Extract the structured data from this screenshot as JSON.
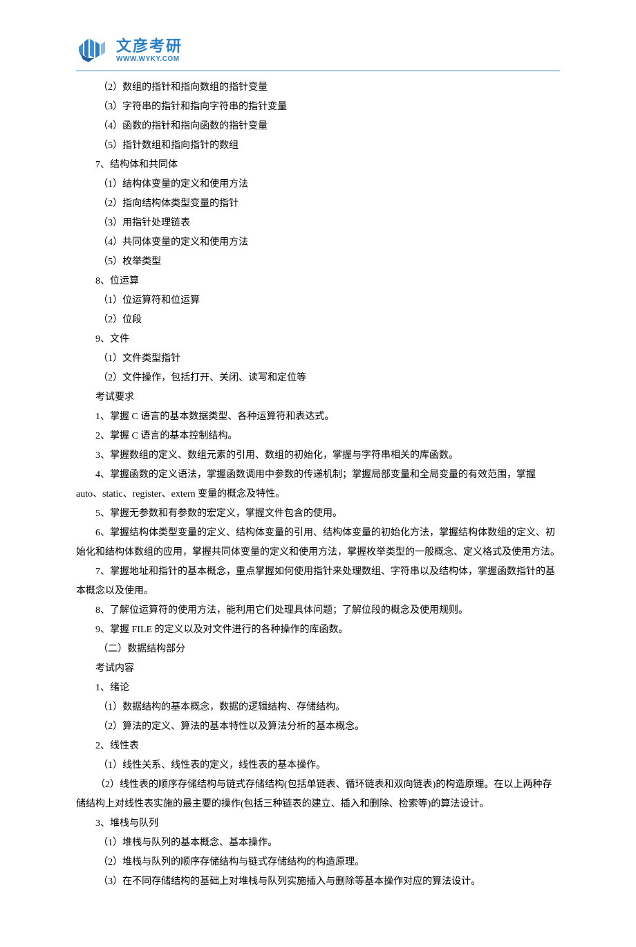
{
  "logo": {
    "cn": "文彦考研",
    "en": "WWW.WYKY.COM"
  },
  "lines": [
    "（2）数组的指针和指向数组的指针变量",
    "（3）字符串的指针和指向字符串的指针变量",
    "（4）函数的指针和指向函数的指针变量",
    "（5）指针数组和指向指针的数组",
    "7、结构体和共同体",
    "（1）结构体变量的定义和使用方法",
    "（2）指向结构体类型变量的指针",
    "（3）用指针处理链表",
    "（4）共同体变量的定义和使用方法",
    "（5）枚举类型",
    "8、位运算",
    "（1）位运算符和位运算",
    "（2）位段",
    "9、文件",
    "（1）文件类型指针",
    "（2）文件操作，包括打开、关闭、读写和定位等",
    "考试要求",
    "1、掌握 C 语言的基本数据类型、各种运算符和表达式。",
    "2、掌握 C 语言的基本控制结构。",
    "3、掌握数组的定义、数组元素的引用、数组的初始化，掌握与字符串相关的库函数。",
    "4、掌握函数的定义语法，掌握函数调用中参数的传递机制；掌握局部变量和全局变量的有效范围，掌握 auto、static、register、extern 变量的概念及特性。",
    "5、掌握无参数和有参数的宏定义，掌握文件包含的使用。",
    "6、掌握结构体类型变量的定义、结构体变量的引用、结构体变量的初始化方法，掌握结构体数组的定义、初始化和结构体数组的应用，掌握共同体变量的定义和使用方法，掌握枚举类型的一般概念、定义格式及使用方法。",
    "7、掌握地址和指针的基本概念，重点掌握如何使用指针来处理数组、字符串以及结构体，掌握函数指针的基本概念以及使用。",
    "8、了解位运算符的使用方法，能利用它们处理具体问题；了解位段的概念及使用规则。",
    "9、掌握 FILE 的定义以及对文件进行的各种操作的库函数。",
    "（二）数据结构部分",
    "考试内容",
    "1、绪论",
    "（1）数据结构的基本概念，数据的逻辑结构、存储结构。",
    "（2）算法的定义、算法的基本特性以及算法分析的基本概念。",
    "2、线性表",
    "（1）线性关系、线性表的定义，线性表的基本操作。",
    "（2）线性表的顺序存储结构与链式存储结构(包括单链表、循环链表和双向链表)的构造原理。在以上两种存储结构上对线性表实施的最主要的操作(包括三种链表的建立、插入和删除、检索等)的算法设计。",
    "3、堆栈与队列",
    "（1）堆栈与队列的基本概念、基本操作。",
    "（2）堆栈与队列的顺序存储结构与链式存储结构的构造原理。",
    "（3）在不同存储结构的基础上对堆栈与队列实施插入与删除等基本操作对应的算法设计。"
  ],
  "multi_line_indices": [
    20,
    22,
    23,
    33
  ]
}
